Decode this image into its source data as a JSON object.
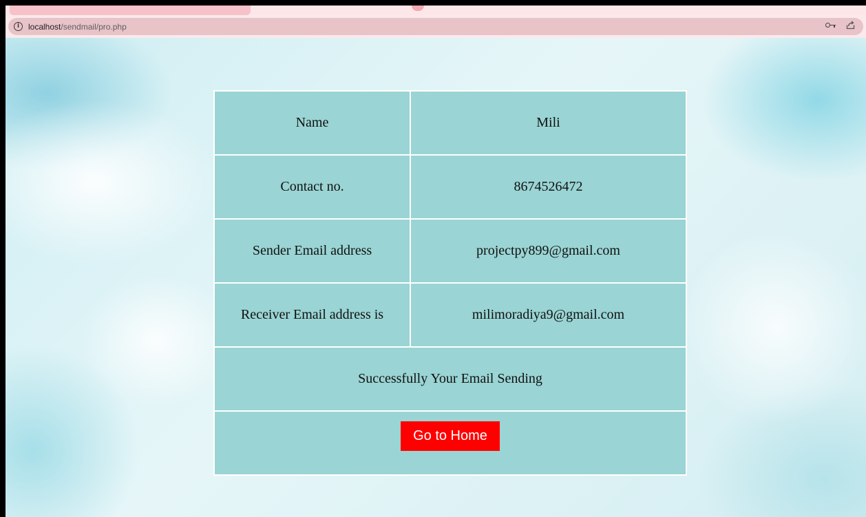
{
  "browser": {
    "url_host": "localhost",
    "url_path": "/sendmail/pro.php"
  },
  "details": {
    "rows": [
      {
        "label": "Name",
        "value": "Mili"
      },
      {
        "label": "Contact no.",
        "value": "8674526472"
      },
      {
        "label": "Sender Email address",
        "value": "projectpy899@gmail.com"
      },
      {
        "label": "Receiver Email address is",
        "value": "milimoradiya9@gmail.com"
      }
    ],
    "status": "Successfully Your Email Sending",
    "home_button": "Go to Home"
  },
  "colors": {
    "cell_bg": "#9ad4d4",
    "button_bg": "#ff0000",
    "button_text": "#ffffff"
  }
}
